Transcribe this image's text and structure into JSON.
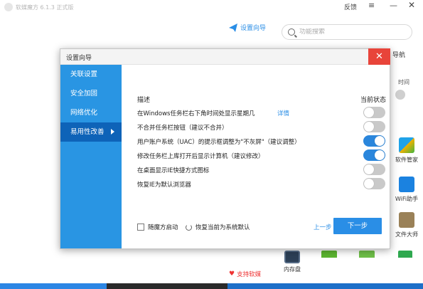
{
  "app": {
    "title": "软媒魔方 6.1.3 正式版",
    "feedback_label": "反馈",
    "menu_glyph": "≡",
    "minimize_glyph": "—",
    "close_glyph": "✕",
    "wizard_link": "设置向导",
    "search_placeholder": "功能搜索",
    "right_nav_label": "导航",
    "right_time_label": "时间",
    "tiles": [
      {
        "label": "软件管家",
        "icon": "software-manager-icon"
      },
      {
        "label": "WiFi助手",
        "icon": "wifi-icon"
      },
      {
        "label": "文件大师",
        "icon": "file-master-icon"
      }
    ],
    "memory_tile_label": "内存盘",
    "support_label": "支持软媒",
    "colors": {
      "accent": "#2a8ee6",
      "sidebar": "#2995e3",
      "sidebar_active": "#0e63b8",
      "close": "#e8443a",
      "toggle_on": "#2a86dc",
      "toggle_off": "#c9c9c9"
    }
  },
  "dialog": {
    "title": "设置向导",
    "close_glyph": "✕",
    "sidebar": [
      {
        "label": "关联设置",
        "active": false
      },
      {
        "label": "安全加固",
        "active": false
      },
      {
        "label": "网络优化",
        "active": false
      },
      {
        "label": "易用性改善",
        "active": true
      }
    ],
    "columns": {
      "description": "描述",
      "state": "当前状态"
    },
    "options": [
      {
        "label": "在Windows任务栏右下角时间处显示星期几",
        "link": "详情",
        "on": false
      },
      {
        "label": "不合并任务栏按钮（建议不合并）",
        "link": "",
        "on": false
      },
      {
        "label": "用户账户系统（UAC）的提示框调整为\"不灰屏\"（建议调整）",
        "link": "",
        "on": true
      },
      {
        "label": "修改任务栏上库打开后显示计算机（建议修改）",
        "link": "",
        "on": true
      },
      {
        "label": "在桌面显示IE快捷方式图标",
        "link": "",
        "on": false
      },
      {
        "label": "恢复IE为默认浏览器",
        "link": "",
        "on": false
      }
    ],
    "footer": {
      "startup_checkbox_label": "随魔方启动",
      "startup_checked": false,
      "restore_label": "恢复当前为系统默认",
      "prev_label": "上一步",
      "next_label": "下一步"
    }
  }
}
